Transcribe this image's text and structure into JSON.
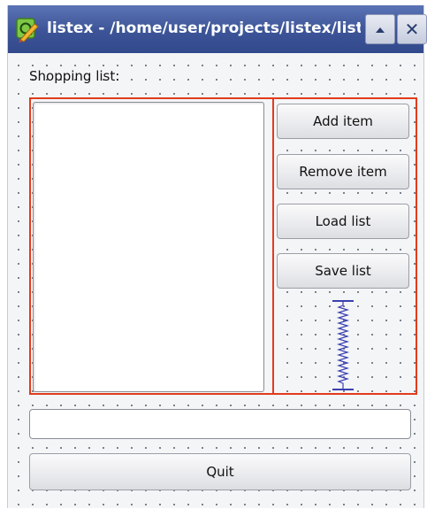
{
  "window": {
    "title": "listex - /home/user/projects/listex/listexb",
    "app_icon": "qt-designer-icon",
    "minimize_icon": "chevron-up-icon",
    "close_icon": "close-icon",
    "close_glyph": "✕"
  },
  "form": {
    "shopping_label": "Shopping list:",
    "list_items": [],
    "line_edit_value": "",
    "buttons": {
      "add": "Add item",
      "remove": "Remove item",
      "load": "Load list",
      "save": "Save list",
      "quit": "Quit"
    }
  },
  "colors": {
    "titlebar": "#3c5497",
    "layout_outline": "#e23b1d",
    "spacer": "#3a3fb0",
    "form_bg": "#f4f5f7"
  }
}
